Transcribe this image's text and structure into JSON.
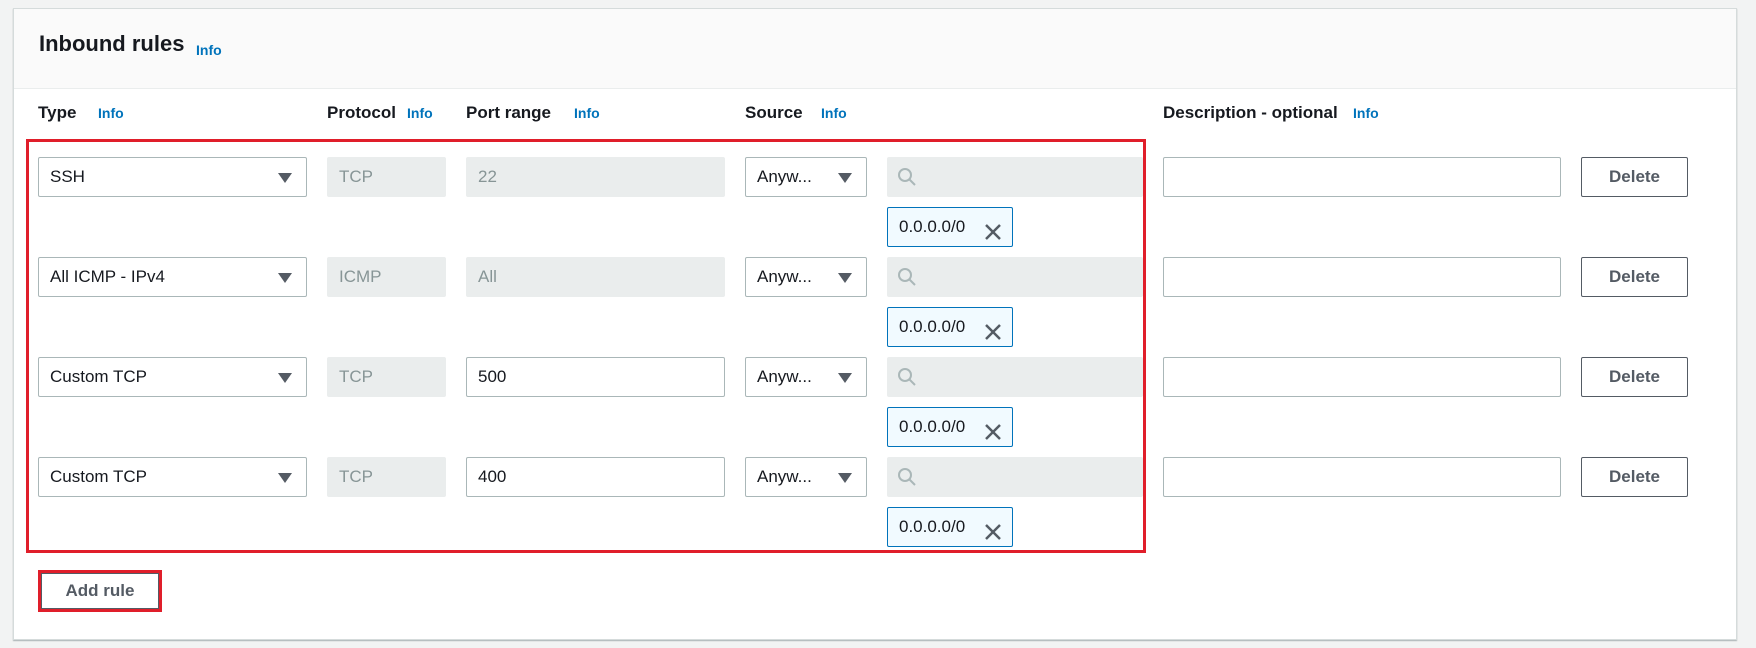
{
  "section": {
    "title": "Inbound rules",
    "info_label": "Info"
  },
  "columns": {
    "type": "Type",
    "protocol": "Protocol",
    "port_range": "Port range",
    "source": "Source",
    "description": "Description - optional",
    "info_label": "Info"
  },
  "rules": [
    {
      "type": "SSH",
      "protocol": "TCP",
      "port_range": "22",
      "port_editable": false,
      "source": "Anyw...",
      "cidr": "0.0.0.0/0",
      "description": "",
      "delete_label": "Delete"
    },
    {
      "type": "All ICMP - IPv4",
      "protocol": "ICMP",
      "port_range": "All",
      "port_editable": false,
      "source": "Anyw...",
      "cidr": "0.0.0.0/0",
      "description": "",
      "delete_label": "Delete"
    },
    {
      "type": "Custom TCP",
      "protocol": "TCP",
      "port_range": "500",
      "port_editable": true,
      "source": "Anyw...",
      "cidr": "0.0.0.0/0",
      "description": "",
      "delete_label": "Delete"
    },
    {
      "type": "Custom TCP",
      "protocol": "TCP",
      "port_range": "400",
      "port_editable": true,
      "source": "Anyw...",
      "cidr": "0.0.0.0/0",
      "description": "",
      "delete_label": "Delete"
    }
  ],
  "add_rule_label": "Add rule",
  "colors": {
    "link": "#0073bb",
    "highlight_border": "#e01e2a",
    "token_border": "#0073bb",
    "token_bg": "#f1faff"
  }
}
